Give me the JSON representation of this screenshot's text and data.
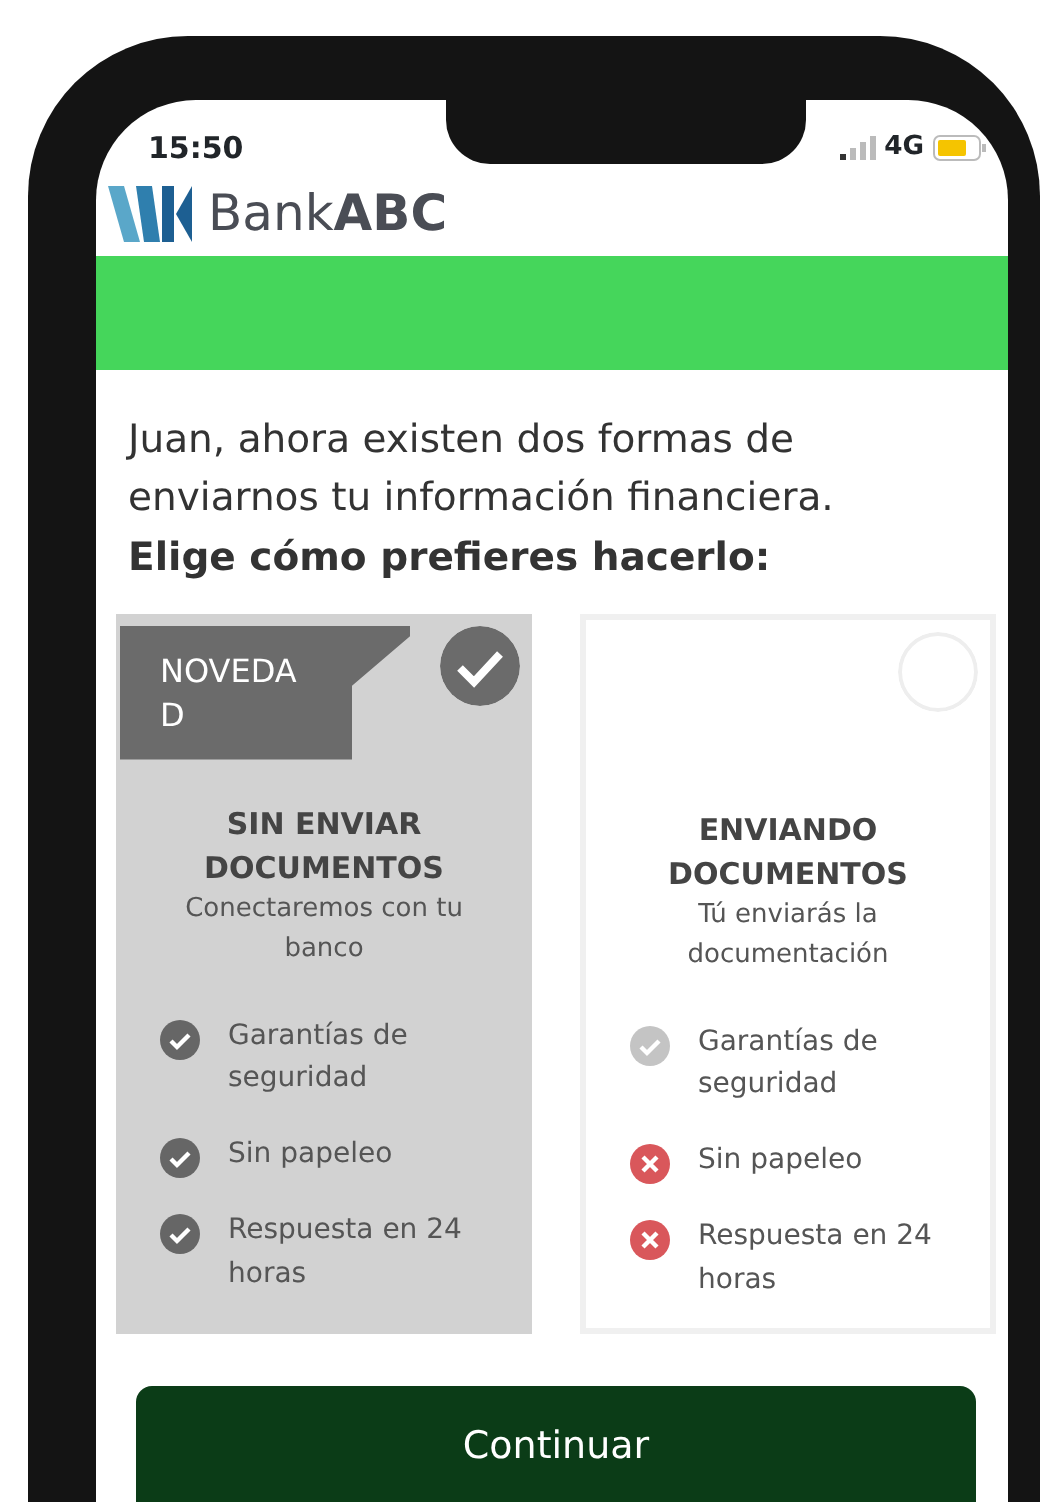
{
  "status_bar": {
    "time": "15:50",
    "network": "4G"
  },
  "header": {
    "brand_light": "Bank",
    "brand_bold": "ABC"
  },
  "intro": "Juan, ahora existen dos formas de enviarnos tu información financiera.",
  "prompt": "Elige cómo prefieres hacerlo:",
  "options": [
    {
      "selected": true,
      "badge": "NOVEDA D",
      "title": "SIN ENVIAR DOCUMENTOS",
      "subtitle": "Conectaremos con tu banco",
      "features": [
        {
          "label": "Garantías de seguridad",
          "included": true
        },
        {
          "label": "Sin papeleo",
          "included": true
        },
        {
          "label": "Respuesta en 24 horas",
          "included": true
        }
      ]
    },
    {
      "selected": false,
      "title": "ENVIANDO DOCUMENTOS",
      "subtitle": "Tú enviarás la documentación",
      "features": [
        {
          "label": "Garantías de seguridad",
          "included": true
        },
        {
          "label": "Sin papeleo",
          "included": false
        },
        {
          "label": "Respuesta en 24 horas",
          "included": false
        }
      ]
    }
  ],
  "continue_button": "Continuar"
}
